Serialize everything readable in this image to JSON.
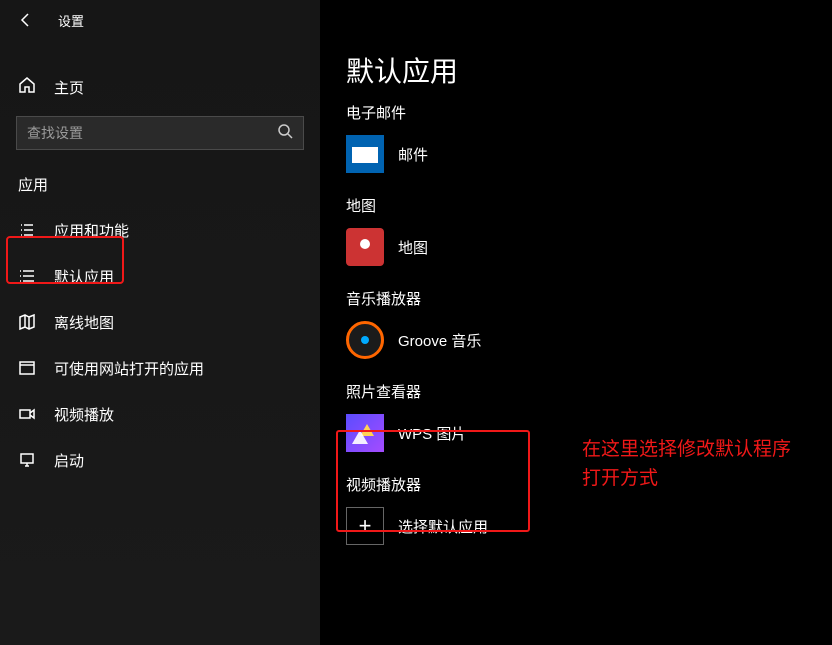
{
  "header": {
    "title": "设置"
  },
  "sidebar": {
    "home": "主页",
    "search_placeholder": "查找设置",
    "section": "应用",
    "items": [
      {
        "label": "应用和功能"
      },
      {
        "label": "默认应用"
      },
      {
        "label": "离线地图"
      },
      {
        "label": "可使用网站打开的应用"
      },
      {
        "label": "视频播放"
      },
      {
        "label": "启动"
      }
    ]
  },
  "main": {
    "title": "默认应用",
    "categories": [
      {
        "label": "电子邮件",
        "app": "邮件"
      },
      {
        "label": "地图",
        "app": "地图"
      },
      {
        "label": "音乐播放器",
        "app": "Groove 音乐"
      },
      {
        "label": "照片查看器",
        "app": "WPS 图片"
      },
      {
        "label": "视频播放器",
        "app": "选择默认应用"
      }
    ]
  },
  "annotation": "在这里选择修改默认程序打开方式"
}
